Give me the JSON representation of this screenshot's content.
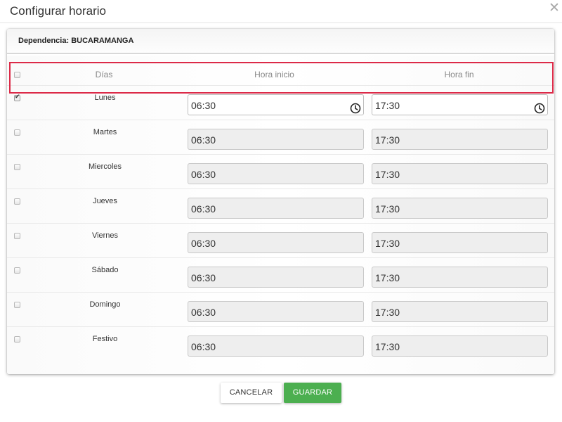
{
  "modal": {
    "title": "Configurar horario",
    "close_icon": "close-icon"
  },
  "dependency": {
    "label": "Dependencia:",
    "value": "BUCARAMANGA"
  },
  "table": {
    "headers": {
      "days": "Días",
      "start": "Hora inicio",
      "end": "Hora fin"
    },
    "header_checkbox_checked": false,
    "rows": [
      {
        "day": "Lunes",
        "checked": true,
        "start": "06:30",
        "end": "17:30",
        "active": true
      },
      {
        "day": "Martes",
        "checked": false,
        "start": "06:30",
        "end": "17:30",
        "active": false
      },
      {
        "day": "Miercoles",
        "checked": false,
        "start": "06:30",
        "end": "17:30",
        "active": false
      },
      {
        "day": "Jueves",
        "checked": false,
        "start": "06:30",
        "end": "17:30",
        "active": false
      },
      {
        "day": "Viernes",
        "checked": false,
        "start": "06:30",
        "end": "17:30",
        "active": false
      },
      {
        "day": "Sábado",
        "checked": false,
        "start": "06:30",
        "end": "17:30",
        "active": false
      },
      {
        "day": "Domingo",
        "checked": false,
        "start": "06:30",
        "end": "17:30",
        "active": false
      },
      {
        "day": "Festivo",
        "checked": false,
        "start": "06:30",
        "end": "17:30",
        "active": false
      }
    ]
  },
  "buttons": {
    "cancel": "CANCELAR",
    "save": "GUARDAR"
  },
  "colors": {
    "save_button": "#4caf50",
    "highlight_border": "#dc2a48",
    "disabled_input": "#eeeeee"
  }
}
